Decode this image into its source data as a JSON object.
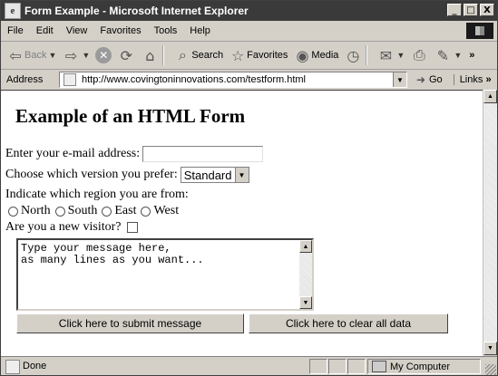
{
  "window": {
    "title": "Form Example - Microsoft Internet Explorer",
    "minimize": "_",
    "maximize": "□",
    "close": "X"
  },
  "menu": {
    "items": [
      "File",
      "Edit",
      "View",
      "Favorites",
      "Tools",
      "Help"
    ]
  },
  "toolbar": {
    "back": "Back",
    "search": "Search",
    "favorites": "Favorites",
    "media": "Media",
    "more": "»"
  },
  "address": {
    "label": "Address",
    "url": "http://www.covingtoninnovations.com/testform.html",
    "go": "Go",
    "links": "Links"
  },
  "page": {
    "heading": "Example of an HTML Form",
    "email_label": "Enter your e-mail address:",
    "email_value": "",
    "version_label": "Choose which version you prefer:",
    "version_selected": "Standard",
    "region_label": "Indicate which region you are from:",
    "regions": [
      "North",
      "South",
      "East",
      "West"
    ],
    "visitor_label": "Are you a new visitor?",
    "message_text": "Type your message here,\nas many lines as you want...",
    "submit_label": "Click here to submit message",
    "clear_label": "Click here to clear all data"
  },
  "status": {
    "text": "Done",
    "zone": "My Computer"
  }
}
